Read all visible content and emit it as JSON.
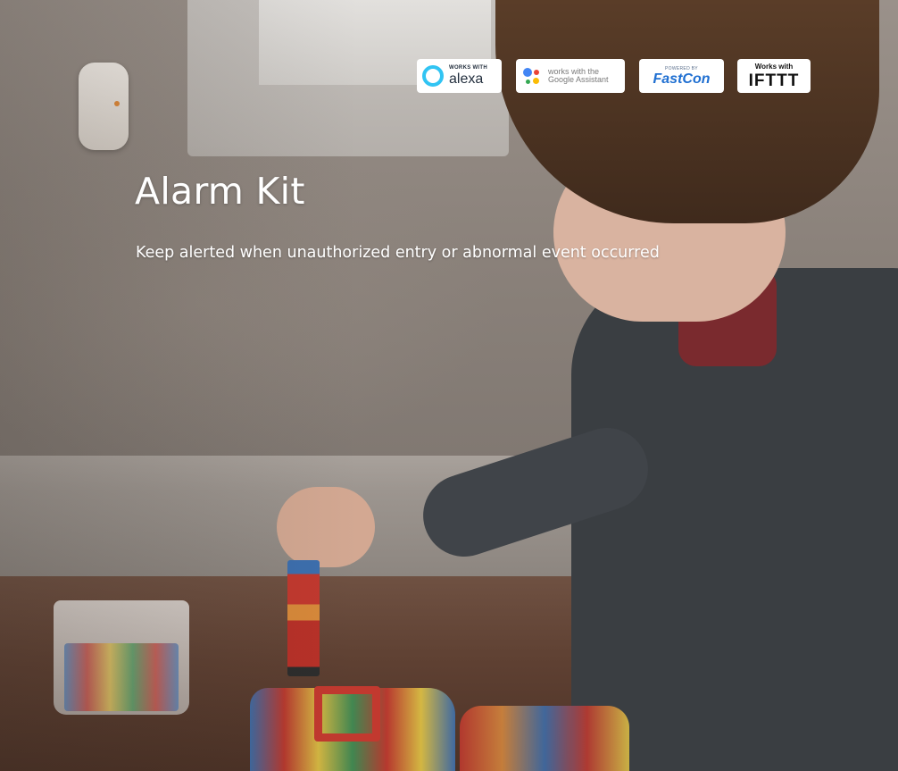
{
  "hero": {
    "title": "Alarm Kit",
    "subtitle": "Keep alerted when unauthorized entry or abnormal event occurred"
  },
  "badges": {
    "alexa": {
      "line1": "WORKS WITH",
      "line2": "alexa",
      "accent": "#31c4f3"
    },
    "google": {
      "line1": "works with the",
      "line2": "Google Assistant"
    },
    "fastcon": {
      "line1": "POWERED BY",
      "line2": "FastCon",
      "accent": "#1f6fd1"
    },
    "ifttt": {
      "line1": "Works with",
      "line2": "IFTTT"
    }
  }
}
